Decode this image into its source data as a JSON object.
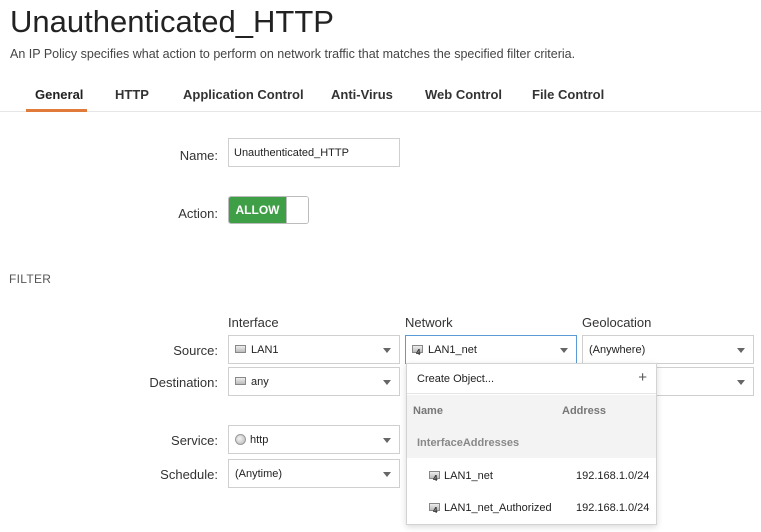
{
  "page": {
    "title": "Unauthenticated_HTTP",
    "description": "An IP Policy specifies what action to perform on network traffic that matches the specified filter criteria."
  },
  "tabs": [
    {
      "label": "General",
      "active": true
    },
    {
      "label": "HTTP"
    },
    {
      "label": "Application Control"
    },
    {
      "label": "Anti-Virus"
    },
    {
      "label": "Web Control"
    },
    {
      "label": "File Control"
    }
  ],
  "form": {
    "name_label": "Name:",
    "name_value": "Unauthenticated_HTTP",
    "action_label": "Action:",
    "action_value": "ALLOW",
    "action_color": "#3f9f46"
  },
  "filter": {
    "section_label": "FILTER",
    "col_interface": "Interface",
    "col_network": "Network",
    "col_geolocation": "Geolocation",
    "source_label": "Source:",
    "destination_label": "Destination:",
    "service_label": "Service:",
    "schedule_label": "Schedule:",
    "source_interface": "LAN1",
    "source_network": "LAN1_net",
    "source_geolocation": "(Anywhere)",
    "destination_interface": "any",
    "service": "http",
    "schedule": "(Anytime)"
  },
  "network_dropdown": {
    "create_label": "Create Object...",
    "plus": "+",
    "col_name": "Name",
    "col_address": "Address",
    "group": "InterfaceAddresses",
    "items": [
      {
        "name": "LAN1_net",
        "address": "192.168.1.0/24"
      },
      {
        "name": "LAN1_net_Authorized",
        "address": "192.168.1.0/24"
      }
    ]
  },
  "icons": {
    "object_icon_number": "4"
  }
}
